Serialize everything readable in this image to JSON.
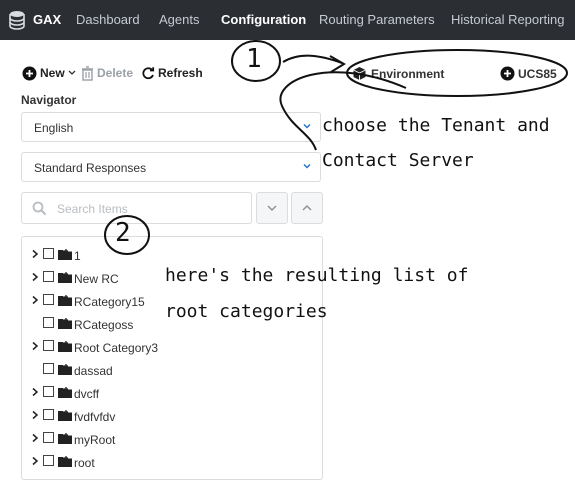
{
  "header": {
    "brand": "GAX",
    "nav": [
      {
        "label": "Dashboard"
      },
      {
        "label": "Agents"
      },
      {
        "label": "Configuration"
      },
      {
        "label": "Routing Parameters"
      },
      {
        "label": "Historical Reporting"
      }
    ],
    "active_tab": "Configuration"
  },
  "toolbar": {
    "new_label": "New",
    "delete_label": "Delete",
    "refresh_label": "Refresh",
    "environment_label": "Environment",
    "tenant_label": "UCS85"
  },
  "navigator": {
    "label": "Navigator",
    "language": "English",
    "object_type": "Standard Responses",
    "search_placeholder": "Search Items"
  },
  "tree": {
    "items": [
      {
        "label": "1",
        "expandable": true
      },
      {
        "label": "New RC",
        "expandable": true
      },
      {
        "label": "RCategory15",
        "expandable": true
      },
      {
        "label": "RCategoss",
        "expandable": false
      },
      {
        "label": "Root Category3",
        "expandable": true
      },
      {
        "label": "dassad",
        "expandable": false
      },
      {
        "label": "dvcff",
        "expandable": true
      },
      {
        "label": "fvdfvfdv",
        "expandable": true
      },
      {
        "label": "myRoot",
        "expandable": true
      },
      {
        "label": "root",
        "expandable": true
      }
    ]
  },
  "annotations": {
    "marker1": "1",
    "marker2": "2",
    "note1_line1": "choose the Tenant and",
    "note1_line2": "Contact Server",
    "note2_line1": "here's the resulting list of",
    "note2_line2": "root categories"
  },
  "colors": {
    "nav_bg": "#2b2e33",
    "nav_active": "#ffffff",
    "border": "#dcdcdc"
  }
}
